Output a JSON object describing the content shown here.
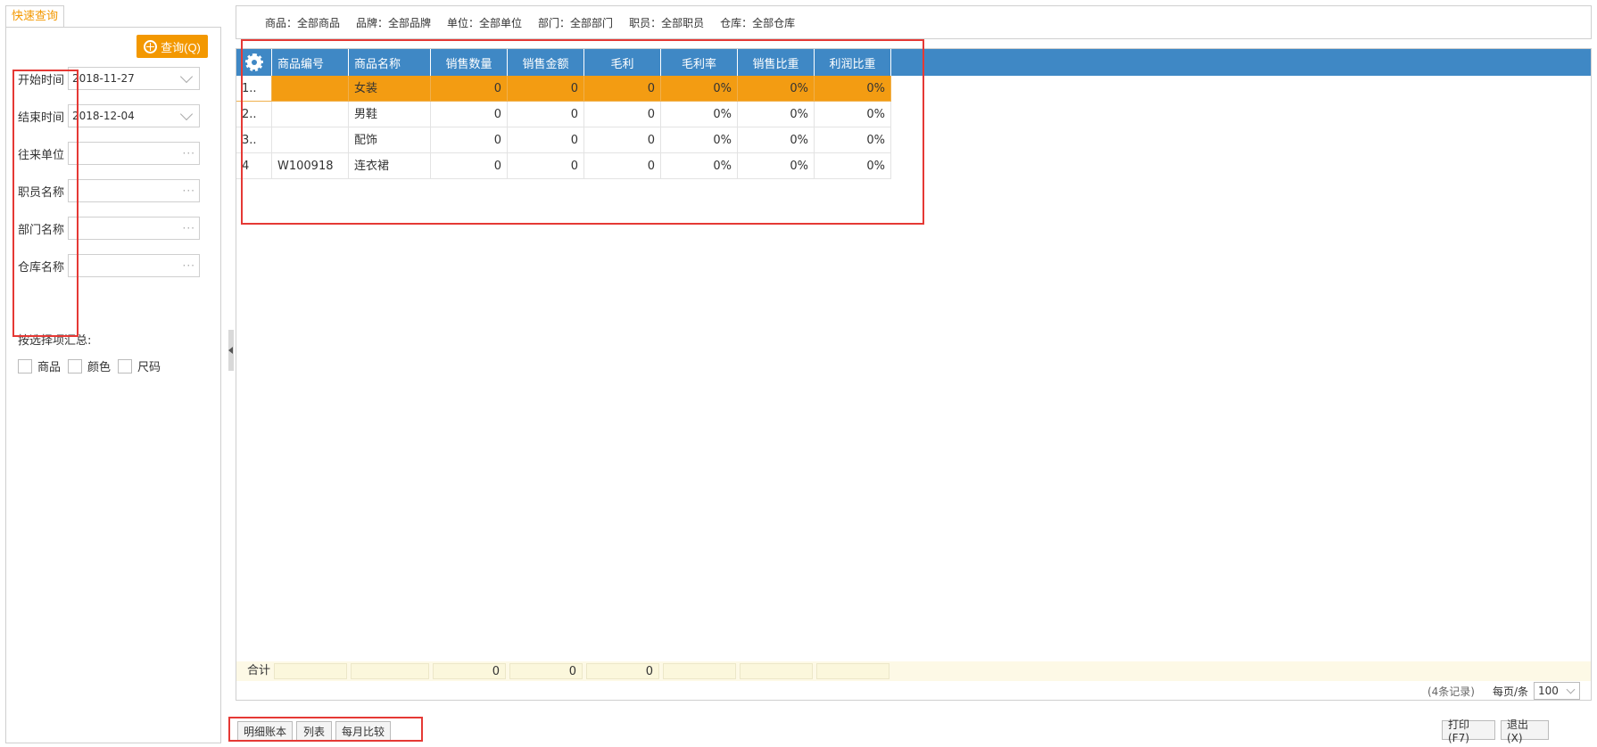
{
  "left_panel": {
    "tab_label": "快速查询",
    "query_button": "查询(Q)",
    "fields": [
      {
        "label": "开始时间",
        "value": "2018-11-27",
        "kind": "date"
      },
      {
        "label": "结束时间",
        "value": "2018-12-04",
        "kind": "date"
      },
      {
        "label": "往来单位",
        "value": "",
        "kind": "picker"
      },
      {
        "label": "职员名称",
        "value": "",
        "kind": "picker"
      },
      {
        "label": "部门名称",
        "value": "",
        "kind": "picker"
      },
      {
        "label": "仓库名称",
        "value": "",
        "kind": "picker"
      }
    ],
    "summary_label": "按选择项汇总:",
    "checkboxes": [
      "商品",
      "颜色",
      "尺码"
    ]
  },
  "filter_bar": [
    "商品：全部商品",
    "品牌：全部品牌",
    "单位：全部单位",
    "部门：全部部门",
    "职员：全部职员",
    "仓库：全部仓库"
  ],
  "grid": {
    "columns": [
      "商品编号",
      "商品名称",
      "销售数量",
      "销售金额",
      "毛利",
      "毛利率",
      "销售比重",
      "利润比重"
    ],
    "rows": [
      {
        "no": "1..",
        "code": "",
        "name": "女装",
        "qty": "0",
        "amount": "0",
        "profit": "0",
        "profit_rate": "0%",
        "sales_share": "0%",
        "profit_share": "0%",
        "selected": true
      },
      {
        "no": "2..",
        "code": "",
        "name": "男鞋",
        "qty": "0",
        "amount": "0",
        "profit": "0",
        "profit_rate": "0%",
        "sales_share": "0%",
        "profit_share": "0%",
        "selected": false
      },
      {
        "no": "3..",
        "code": "",
        "name": "配饰",
        "qty": "0",
        "amount": "0",
        "profit": "0",
        "profit_rate": "0%",
        "sales_share": "0%",
        "profit_share": "0%",
        "selected": false
      },
      {
        "no": "4",
        "code": "W100918",
        "name": "连衣裙",
        "qty": "0",
        "amount": "0",
        "profit": "0",
        "profit_rate": "0%",
        "sales_share": "0%",
        "profit_share": "0%",
        "selected": false
      }
    ],
    "footer": {
      "label": "合计",
      "qty": "0",
      "amount": "0",
      "profit": "0"
    }
  },
  "pager": {
    "records": "(4条记录)",
    "page_size_label": "每页/条",
    "page_size": "100"
  },
  "bottom_buttons": {
    "detail_ledger": "明细账本",
    "list": "列表",
    "monthly_compare": "每月比较",
    "print": "打印(F7)",
    "exit": "退出(X)"
  },
  "colors": {
    "accent_orange": "#f39800",
    "header_blue": "#3f88c5",
    "selected_row": "#f39c12",
    "annotation_red": "#e53935"
  }
}
